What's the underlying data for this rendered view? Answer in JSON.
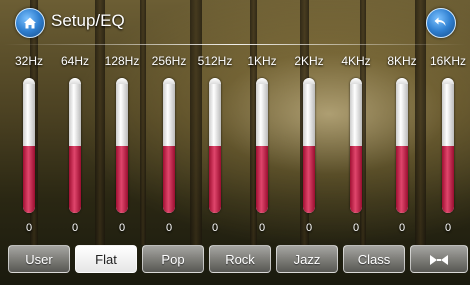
{
  "header": {
    "title": "Setup/EQ"
  },
  "icons": {
    "home": "home-icon",
    "back": "back-arrow-icon",
    "adjust": "bowtie-adjust-icon"
  },
  "colors": {
    "fill": "#d83a60",
    "accent": "#2f7fd0"
  },
  "bands": [
    {
      "label": "32Hz",
      "value": "0",
      "level": 0.5
    },
    {
      "label": "64Hz",
      "value": "0",
      "level": 0.5
    },
    {
      "label": "128Hz",
      "value": "0",
      "level": 0.5
    },
    {
      "label": "256Hz",
      "value": "0",
      "level": 0.5
    },
    {
      "label": "512Hz",
      "value": "0",
      "level": 0.5
    },
    {
      "label": "1KHz",
      "value": "0",
      "level": 0.5
    },
    {
      "label": "2KHz",
      "value": "0",
      "level": 0.5
    },
    {
      "label": "4KHz",
      "value": "0",
      "level": 0.5
    },
    {
      "label": "8KHz",
      "value": "0",
      "level": 0.5
    },
    {
      "label": "16KHz",
      "value": "0",
      "level": 0.5
    }
  ],
  "presets": [
    {
      "label": "User",
      "active": false
    },
    {
      "label": "Flat",
      "active": true
    },
    {
      "label": "Pop",
      "active": false
    },
    {
      "label": "Rock",
      "active": false
    },
    {
      "label": "Jazz",
      "active": false
    },
    {
      "label": "Class",
      "active": false
    }
  ]
}
